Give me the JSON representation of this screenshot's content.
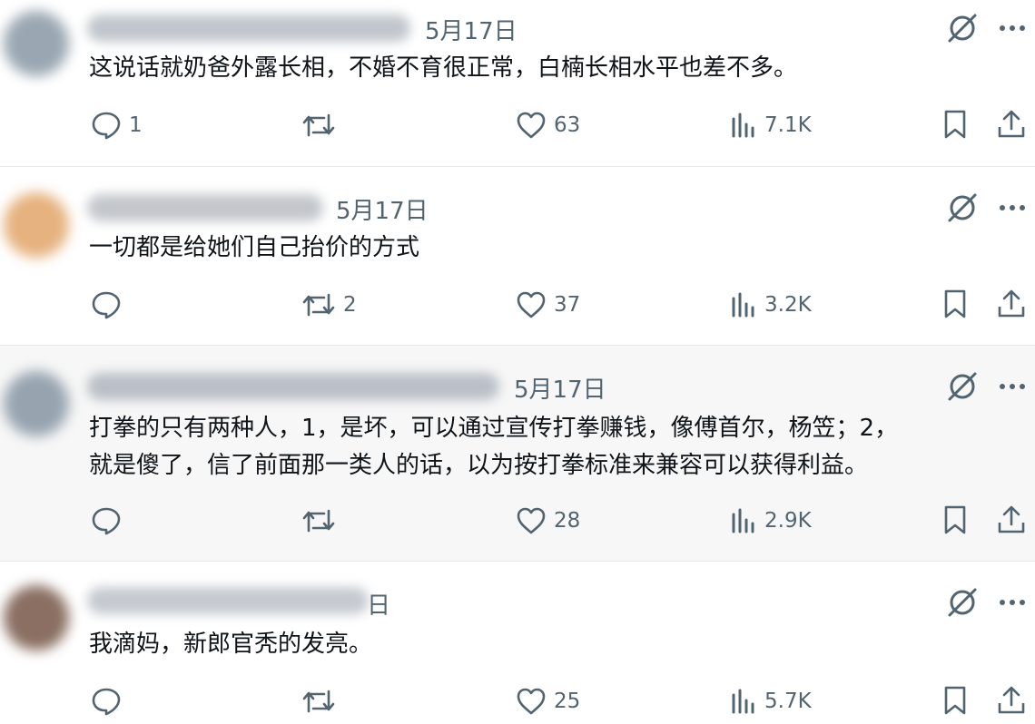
{
  "posts": [
    {
      "date": "5月17日",
      "text_lines": [
        "这说话就奶爸外露长相，不婚不育很正常，白楠长相水平也差不多。"
      ],
      "replies": "1",
      "reposts": "",
      "likes": "63",
      "views": "7.1K",
      "highlighted": false,
      "avatar_color": "#9aa7b2",
      "name_color": "#bfc5cb"
    },
    {
      "date": "5月17日",
      "text_lines": [
        "一切都是给她们自己抬价的方式"
      ],
      "replies": "",
      "reposts": "2",
      "likes": "37",
      "views": "3.2K",
      "highlighted": false,
      "avatar_color": "#e6b27f",
      "name_color": "#c3c7cc"
    },
    {
      "date": "5月17日",
      "text_lines": [
        "打拳的只有两种人，1，是坏，可以通过宣传打拳赚钱，像傅首尔，杨笠；2，",
        "就是傻了，信了前面那一类人的话，以为按打拳标准来兼容可以获得利益。"
      ],
      "replies": "",
      "reposts": "",
      "likes": "28",
      "views": "2.9K",
      "highlighted": true,
      "avatar_color": "#97a4b0",
      "name_color": "#b9bfc6"
    },
    {
      "date": "日",
      "text_lines": [
        "我滴妈，新郎官秃的发亮。"
      ],
      "replies": "",
      "reposts": "",
      "likes": "25",
      "views": "5.7K",
      "highlighted": false,
      "avatar_color": "#8a6f62",
      "name_color": "#c5cad0"
    }
  ],
  "icons": {
    "reply": "reply-icon",
    "repost": "repost-icon",
    "like": "like-icon",
    "views": "views-icon",
    "bookmark": "bookmark-icon",
    "share": "share-icon",
    "grok": "grok-icon",
    "more": "more-icon"
  },
  "colors": {
    "icon": "#536471",
    "text": "#0f1419",
    "highlight_bg": "#f7f7f7"
  }
}
